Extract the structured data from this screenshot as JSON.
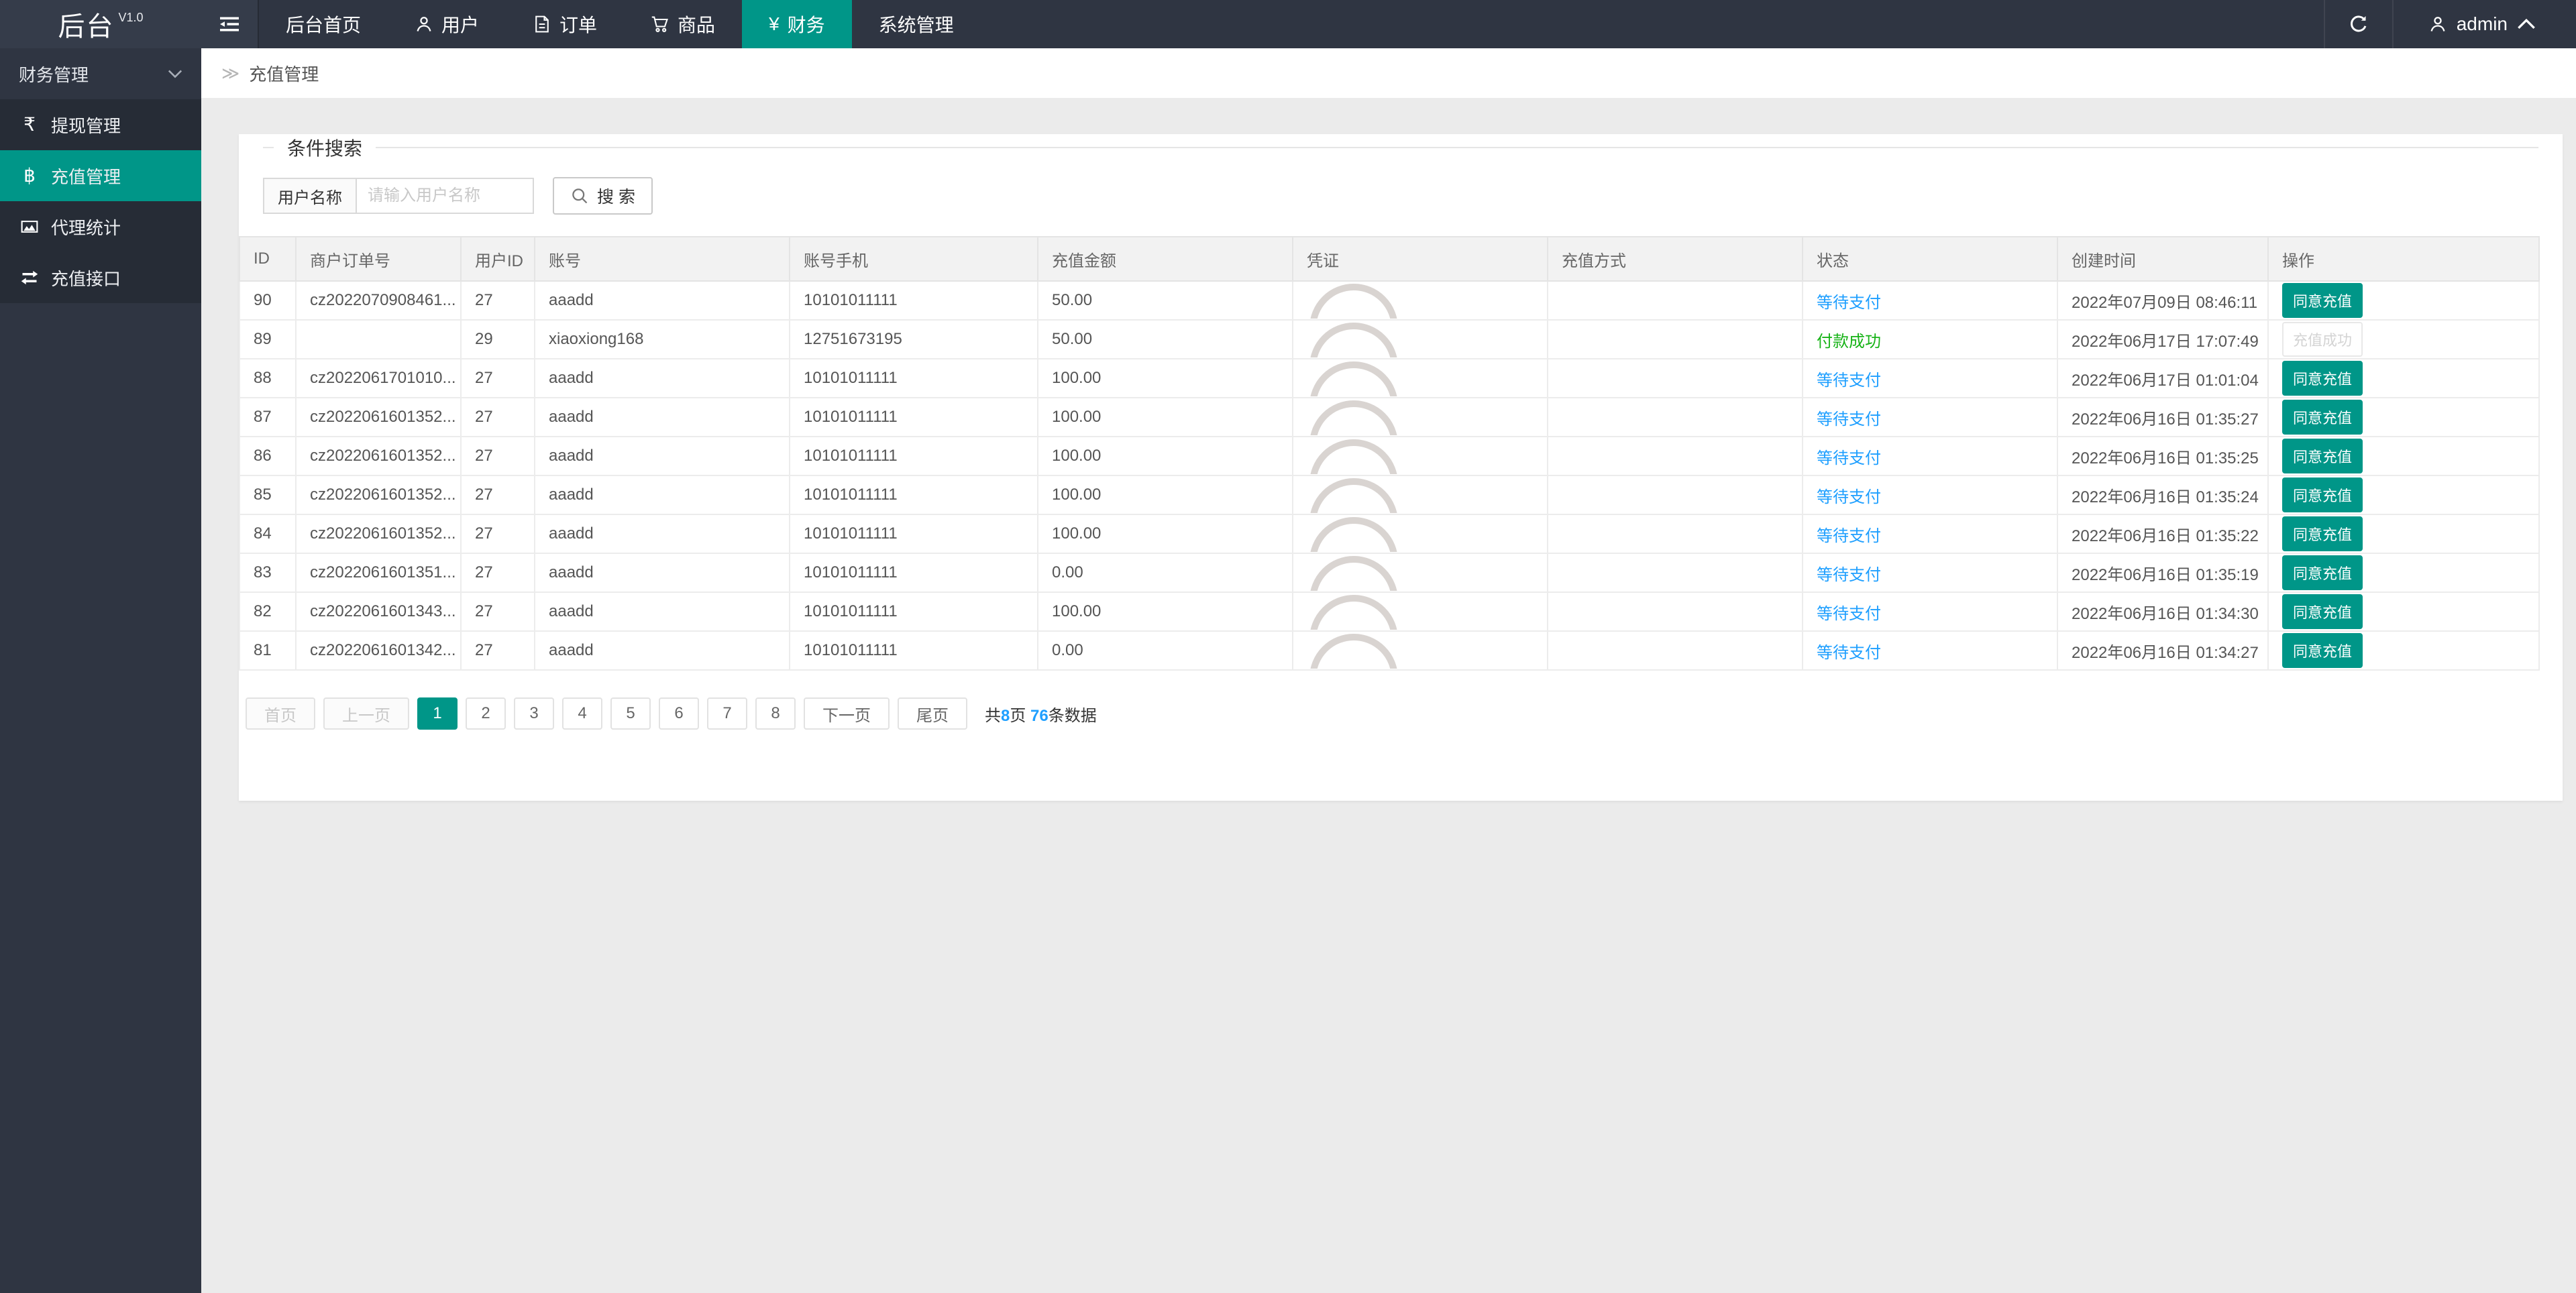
{
  "app": {
    "title": "后台",
    "version": "V1.0"
  },
  "navbar": {
    "menu": [
      {
        "key": "home",
        "label": "后台首页",
        "icon": null,
        "active": false
      },
      {
        "key": "users",
        "label": "用户",
        "icon": "user-icon",
        "active": false
      },
      {
        "key": "orders",
        "label": "订单",
        "icon": "order-icon",
        "active": false
      },
      {
        "key": "goods",
        "label": "商品",
        "icon": "goods-icon",
        "active": false
      },
      {
        "key": "finance",
        "label": "财务",
        "icon": "finance-icon",
        "active": true
      },
      {
        "key": "system",
        "label": "系统管理",
        "icon": null,
        "active": false
      }
    ],
    "user": "admin"
  },
  "sidebar": {
    "group": "财务管理",
    "items": [
      {
        "key": "withdraw-manage",
        "label": "提现管理",
        "icon": "rupee-icon",
        "active": false
      },
      {
        "key": "recharge-manage",
        "label": "充值管理",
        "icon": "bitcoin-icon",
        "active": true
      },
      {
        "key": "agent-stats",
        "label": "代理统计",
        "icon": "chart-icon",
        "active": false
      },
      {
        "key": "recharge-api",
        "label": "充值接口",
        "icon": "exchange-icon",
        "active": false
      }
    ]
  },
  "breadcrumb": "充值管理",
  "search": {
    "legend": "条件搜索",
    "label": "用户名称",
    "placeholder": "请输入用户名称",
    "button": "搜 索"
  },
  "table": {
    "headers": [
      "ID",
      "商户订单号",
      "用户ID",
      "账号",
      "账号手机",
      "充值金额",
      "凭证",
      "充值方式",
      "状态",
      "创建时间",
      "操作"
    ],
    "rows": [
      {
        "id": "90",
        "order_no": "cz2022070908461...",
        "user_id": "27",
        "account": "aaadd",
        "phone": "10101011111",
        "amount": "50.00",
        "voucher": "arc-image",
        "method": "",
        "status": "waiting",
        "created": "2022年07月09日 08:46:11",
        "action": "approve"
      },
      {
        "id": "89",
        "order_no": "",
        "user_id": "29",
        "account": "xiaoxiong168",
        "phone": "12751673195",
        "amount": "50.00",
        "voucher": "arc-image",
        "method": "",
        "status": "paid",
        "created": "2022年06月17日 17:07:49",
        "action": "done"
      },
      {
        "id": "88",
        "order_no": "cz2022061701010...",
        "user_id": "27",
        "account": "aaadd",
        "phone": "10101011111",
        "amount": "100.00",
        "voucher": "arc-image",
        "method": "",
        "status": "waiting",
        "created": "2022年06月17日 01:01:04",
        "action": "approve"
      },
      {
        "id": "87",
        "order_no": "cz2022061601352...",
        "user_id": "27",
        "account": "aaadd",
        "phone": "10101011111",
        "amount": "100.00",
        "voucher": "arc-image",
        "method": "",
        "status": "waiting",
        "created": "2022年06月16日 01:35:27",
        "action": "approve"
      },
      {
        "id": "86",
        "order_no": "cz2022061601352...",
        "user_id": "27",
        "account": "aaadd",
        "phone": "10101011111",
        "amount": "100.00",
        "voucher": "arc-image",
        "method": "",
        "status": "waiting",
        "created": "2022年06月16日 01:35:25",
        "action": "approve"
      },
      {
        "id": "85",
        "order_no": "cz2022061601352...",
        "user_id": "27",
        "account": "aaadd",
        "phone": "10101011111",
        "amount": "100.00",
        "voucher": "arc-image",
        "method": "",
        "status": "waiting",
        "created": "2022年06月16日 01:35:24",
        "action": "approve"
      },
      {
        "id": "84",
        "order_no": "cz2022061601352...",
        "user_id": "27",
        "account": "aaadd",
        "phone": "10101011111",
        "amount": "100.00",
        "voucher": "arc-image",
        "method": "",
        "status": "waiting",
        "created": "2022年06月16日 01:35:22",
        "action": "approve"
      },
      {
        "id": "83",
        "order_no": "cz2022061601351...",
        "user_id": "27",
        "account": "aaadd",
        "phone": "10101011111",
        "amount": "0.00",
        "voucher": "arc-image",
        "method": "",
        "status": "waiting",
        "created": "2022年06月16日 01:35:19",
        "action": "approve"
      },
      {
        "id": "82",
        "order_no": "cz2022061601343...",
        "user_id": "27",
        "account": "aaadd",
        "phone": "10101011111",
        "amount": "100.00",
        "voucher": "arc-image",
        "method": "",
        "status": "waiting",
        "created": "2022年06月16日 01:34:30",
        "action": "approve"
      },
      {
        "id": "81",
        "order_no": "cz2022061601342...",
        "user_id": "27",
        "account": "aaadd",
        "phone": "10101011111",
        "amount": "0.00",
        "voucher": "arc-image",
        "method": "",
        "status": "waiting",
        "created": "2022年06月16日 01:34:27",
        "action": "approve"
      }
    ]
  },
  "status_labels": {
    "waiting": "等待支付",
    "paid": "付款成功"
  },
  "action_labels": {
    "approve": "同意充值",
    "done": "充值成功"
  },
  "pagination": {
    "first": "首页",
    "prev": "上一页",
    "pages": [
      "1",
      "2",
      "3",
      "4",
      "5",
      "6",
      "7",
      "8"
    ],
    "current": "1",
    "next": "下一页",
    "last": "尾页",
    "total_prefix": "共",
    "total_pages": "8",
    "pages_suffix": "页 ",
    "total_records": "76",
    "records_suffix": "条数据"
  },
  "colors": {
    "accent": "#009688",
    "navbar": "#2F3542",
    "sidebar_items": "#262C36",
    "status_waiting": "#1E9FFF",
    "status_paid": "#17B317",
    "link": "#1E9FFF"
  }
}
